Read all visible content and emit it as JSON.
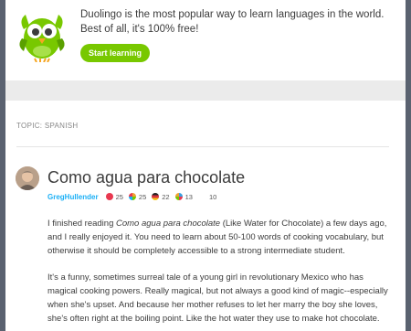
{
  "promo": {
    "text": "Duolingo is the most popular way to learn languages in the world. Best of all, it's 100% free!",
    "button_label": "Start learning"
  },
  "topic": {
    "label": "TOPIC: SPANISH"
  },
  "post": {
    "title": "Como agua para chocolate",
    "author": "GregHullender",
    "flags": [
      {
        "icon": "flag-spain-icon",
        "count": "25",
        "color": "#e8384f"
      },
      {
        "icon": "flag-multicolor-icon",
        "count": "25",
        "color": "#f0a030"
      },
      {
        "icon": "flag-germany-icon",
        "count": "22",
        "color": "#d8323c"
      },
      {
        "icon": "flag-multicolor-icon",
        "count": "13",
        "color": "#3aa0e0"
      }
    ],
    "replies": "10",
    "paragraph1_pre": "I finished reading ",
    "paragraph1_em": "Como agua para chocolate",
    "paragraph1_post": " (Like Water for Chocolate) a few days ago, and I really enjoyed it. You need to learn about 50-100 words of cooking vocabulary, but otherwise it should be completely accessible to a strong intermediate student.",
    "paragraph2": "It's a funny, sometimes surreal tale of a young girl in revolutionary Mexico who has magical cooking powers. Really magical, but not always a good kind of magic--especially when she's upset. And because her mother refuses to let her marry the boy she loves, she's often right at the boiling point. Like the hot water they use to make hot chocolate."
  },
  "colors": {
    "brand_green": "#78c800",
    "link_blue": "#1cb0f6",
    "frame": "#5a6270"
  }
}
